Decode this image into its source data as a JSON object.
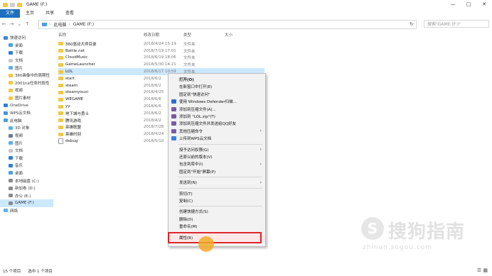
{
  "window": {
    "title": "GAME (F:)",
    "controls": [
      "—",
      "□",
      "✕"
    ]
  },
  "ribbon": {
    "tabs": [
      "文件",
      "主页",
      "共享",
      "查看"
    ]
  },
  "address": {
    "segments": [
      "此电脑",
      "GAME (F:)"
    ],
    "search_placeholder": "搜索\"GAME (F:)\""
  },
  "sidebar": {
    "items": [
      {
        "label": "快速访问",
        "color": "#3a86d6"
      },
      {
        "label": "桌面",
        "color": "#4a9fe0"
      },
      {
        "label": "下载",
        "color": "#2f7fd4"
      },
      {
        "label": "文档",
        "color": "#c9c9c9"
      },
      {
        "label": "图片",
        "color": "#5db0e8"
      },
      {
        "label": "360画像中的周期性",
        "color": "#f2c744"
      },
      {
        "label": "2001na任务时段性",
        "color": "#f2c744"
      },
      {
        "label": "视频",
        "color": "#f2c744"
      },
      {
        "label": "图片素材",
        "color": "#f2c744"
      },
      {
        "label": "OneDrive",
        "color": "#2f7fd4"
      },
      {
        "label": "WPS云文档",
        "color": "#4a90e2"
      },
      {
        "label": "此电脑",
        "color": "#4a9fe0"
      },
      {
        "label": "3D 对象",
        "color": "#5db0e8"
      },
      {
        "label": "视频",
        "color": "#6b7b8c"
      },
      {
        "label": "图片",
        "color": "#5db0e8"
      },
      {
        "label": "文档",
        "color": "#c9c9c9"
      },
      {
        "label": "下载",
        "color": "#2f7fd4"
      },
      {
        "label": "音乐",
        "color": "#2f7fd4"
      },
      {
        "label": "桌面",
        "color": "#4a9fe0"
      },
      {
        "label": "本地磁盘 (C:)",
        "color": "#8a8a8a"
      },
      {
        "label": "新加卷 (D:)",
        "color": "#8a8a8a"
      },
      {
        "label": "办公 (E:)",
        "color": "#8a8a8a"
      },
      {
        "label": "GAME (F:)",
        "color": "#8a8a8a"
      },
      {
        "label": "网络",
        "color": "#5db0e8"
      }
    ]
  },
  "columns": {
    "name": "名称",
    "date": "修改日期",
    "type": "类型",
    "size": "大小"
  },
  "files": [
    {
      "name": "360驱动大师目录",
      "date": "2018/4/24 15:19",
      "type": "文件夹"
    },
    {
      "name": "Battle.net",
      "date": "2018/7/19 17:01",
      "type": "文件夹"
    },
    {
      "name": "CloudMusic",
      "date": "2018/6/19 18:06",
      "type": "文件夹"
    },
    {
      "name": "GameLauncher",
      "date": "2018/5/30 14:21",
      "type": "文件夹"
    },
    {
      "name": "LOL",
      "date": "2018/6/17 10:59",
      "type": "文件夹"
    },
    {
      "name": "start",
      "date": "2018/6/2",
      "type": ""
    },
    {
      "name": "steam",
      "date": "2018/6/2",
      "type": ""
    },
    {
      "name": "steamyouxi",
      "date": "2018/4/25",
      "type": ""
    },
    {
      "name": "WEGAME",
      "date": "2018/6/6",
      "type": ""
    },
    {
      "name": "yy",
      "date": "2018/6/6",
      "type": ""
    },
    {
      "name": "地下城与勇士",
      "date": "2018/6/2",
      "type": ""
    },
    {
      "name": "腾讯游戏",
      "date": "2018/4/2",
      "type": ""
    },
    {
      "name": "英雄联盟",
      "date": "2018/7/28",
      "type": ""
    },
    {
      "name": "英雄时刻",
      "date": "2018/4/24",
      "type": ""
    },
    {
      "name": "debug",
      "date": "2018/5/10",
      "type": ""
    }
  ],
  "context_menu": {
    "groups": [
      [
        {
          "label": "打开(O)",
          "bold": true,
          "icon": "",
          "arrow": false
        },
        {
          "label": "在新窗口中打开(E)",
          "bold": false,
          "icon": "",
          "arrow": false
        },
        {
          "label": "固定到\"快速访问\"",
          "bold": false,
          "icon": "",
          "arrow": false
        },
        {
          "label": "使用 Windows Defender扫描...",
          "bold": false,
          "icon": "#2f6fd0",
          "arrow": false
        },
        {
          "label": "添加到压缩文件(A)...",
          "bold": false,
          "icon": "#7a5aa8",
          "arrow": false
        },
        {
          "label": "添加到 \"LOL.zip\"(T)",
          "bold": false,
          "icon": "#7a5aa8",
          "arrow": false
        },
        {
          "label": "添加到压缩文件并发送给QQ好友",
          "bold": false,
          "icon": "#7a5aa8",
          "arrow": false
        },
        {
          "label": "其他压缩命令",
          "bold": false,
          "icon": "#7a5aa8",
          "arrow": true
        },
        {
          "label": "上传到WPS云文档",
          "bold": false,
          "icon": "#3c7fe0",
          "arrow": false
        }
      ],
      [
        {
          "label": "授予访问权限(G)",
          "bold": false,
          "icon": "",
          "arrow": true
        },
        {
          "label": "还原以前的版本(V)",
          "bold": false,
          "icon": "",
          "arrow": false
        },
        {
          "label": "包含到库中(I)",
          "bold": false,
          "icon": "",
          "arrow": true
        },
        {
          "label": "固定到\"开始\"屏幕(P)",
          "bold": false,
          "icon": "",
          "arrow": false
        }
      ],
      [
        {
          "label": "发送到(N)",
          "bold": false,
          "icon": "",
          "arrow": true
        }
      ],
      [
        {
          "label": "剪切(T)",
          "bold": false,
          "icon": "",
          "arrow": false
        },
        {
          "label": "复制(C)",
          "bold": false,
          "icon": "",
          "arrow": false
        }
      ],
      [
        {
          "label": "创建快捷方式(S)",
          "bold": false,
          "icon": "",
          "arrow": false
        },
        {
          "label": "删除(D)",
          "bold": false,
          "icon": "",
          "arrow": false
        },
        {
          "label": "重命名(M)",
          "bold": false,
          "icon": "",
          "arrow": false
        }
      ],
      [
        {
          "label": "属性(R)",
          "bold": false,
          "icon": "",
          "arrow": false
        }
      ]
    ]
  },
  "status": {
    "count": "15 个项目",
    "selected": "选中 1 个项目"
  },
  "watermark": {
    "text": "搜狗指南",
    "url": "zhinan.sogou.com",
    "glyph": "S"
  }
}
